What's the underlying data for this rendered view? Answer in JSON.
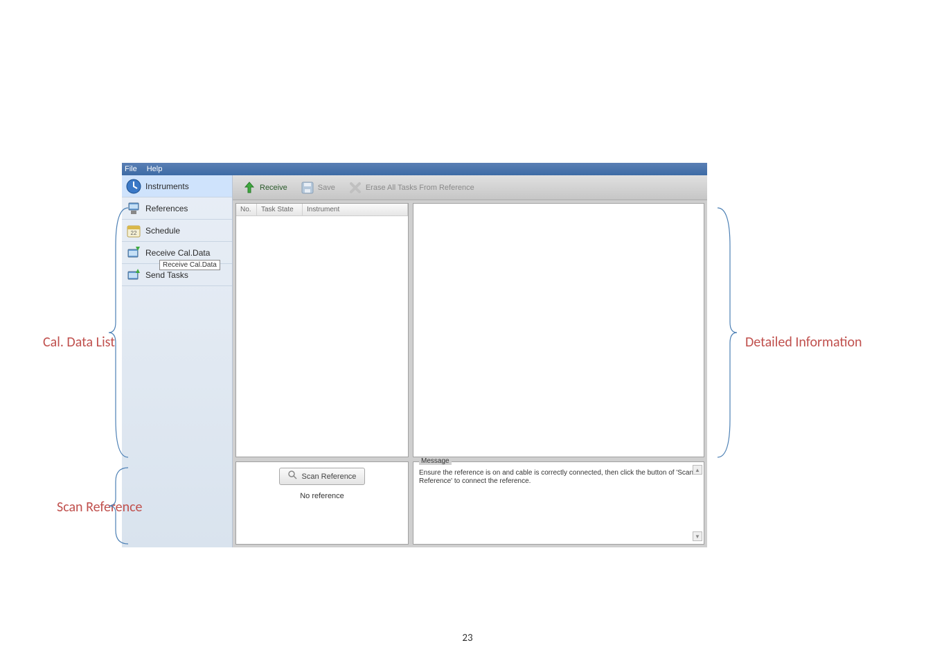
{
  "menu": {
    "file": "File",
    "help": "Help"
  },
  "sidebar": {
    "items": [
      {
        "label": "Instruments"
      },
      {
        "label": "References"
      },
      {
        "label": "Schedule"
      },
      {
        "label": "Receive Cal.Data",
        "tooltip": "Receive Cal.Data"
      },
      {
        "label": "Send Tasks"
      }
    ]
  },
  "toolbar": {
    "receive": "Receive",
    "save": "Save",
    "erase": "Erase All Tasks From Reference"
  },
  "list": {
    "col_no": "No.",
    "col_taskstate": "Task State",
    "col_instrument": "Instrument"
  },
  "scan": {
    "button": "Scan Reference",
    "status": "No reference"
  },
  "message": {
    "legend": "Message",
    "text": "Ensure the reference is on and cable is correctly connected, then click the button of 'Scan Reference' to connect the reference."
  },
  "annotations": {
    "cal_data_list": "Cal. Data List",
    "scan_reference": "Scan Reference",
    "detailed_info": "Detailed Information"
  },
  "page_number": "23"
}
